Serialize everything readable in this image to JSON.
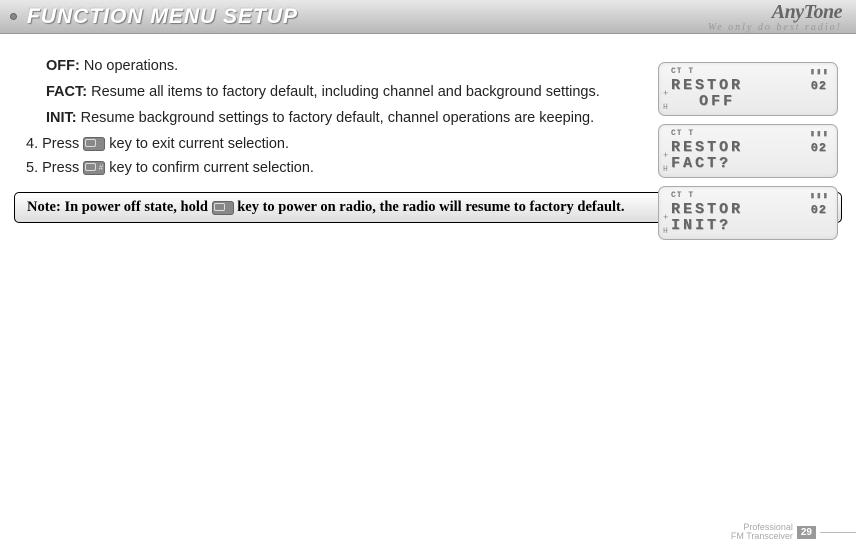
{
  "header": {
    "title": "FUNCTION MENU SETUP",
    "brand": "AnyTone",
    "tagline": "We only do best radio!"
  },
  "options": {
    "off": {
      "label": "OFF:",
      "text": "No operations."
    },
    "fact": {
      "label": "FACT:",
      "text": "Resume all items to factory default, including channel and background settings."
    },
    "init": {
      "label": "INIT:",
      "text": "Resume background settings to factory default, channel operations are keeping."
    }
  },
  "steps": {
    "s4": {
      "num": "4.",
      "pre": "Press ",
      "post": " key to exit current selection."
    },
    "s5": {
      "num": "5.",
      "pre": "Press ",
      "post": " key to confirm current selection."
    }
  },
  "note": {
    "pre": "Note: In power off  state, hold ",
    "post": " key to power on radio,  the radio will resume to factory default."
  },
  "lcd": {
    "top_ct": "CT",
    "top_t": "T",
    "val02": "02",
    "l1a": "RESTOR",
    "l1b": "OFF",
    "l2a": "RESTOR",
    "l2b": "FACT?",
    "l3a": "RESTOR",
    "l3b": "INIT?",
    "side": "+",
    "h": "H"
  },
  "footer": {
    "line1": "Professional",
    "line2": "FM Transceiver",
    "page": "29"
  }
}
